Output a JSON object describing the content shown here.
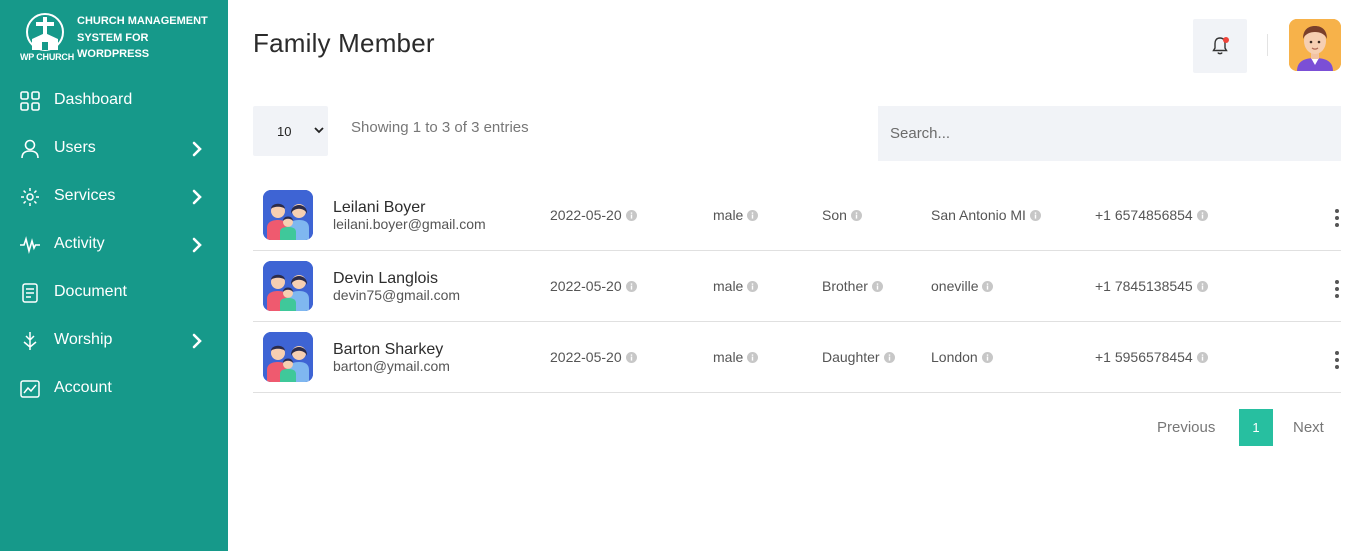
{
  "brand": {
    "logo_text": "WP CHURCH",
    "title": "CHURCH MANAGEMENT SYSTEM FOR WORDPRESS"
  },
  "sidebar": {
    "items": [
      {
        "label": "Dashboard",
        "icon": "dashboard-grid-icon",
        "has_chevron": false
      },
      {
        "label": "Users",
        "icon": "user-icon",
        "has_chevron": true
      },
      {
        "label": "Services",
        "icon": "services-icon",
        "has_chevron": true
      },
      {
        "label": "Activity",
        "icon": "activity-pulse-icon",
        "has_chevron": true
      },
      {
        "label": "Document",
        "icon": "document-icon",
        "has_chevron": false
      },
      {
        "label": "Worship",
        "icon": "worship-icon",
        "has_chevron": true
      },
      {
        "label": "Account",
        "icon": "account-chart-icon",
        "has_chevron": false
      }
    ]
  },
  "header": {
    "title": "Family Member"
  },
  "controls": {
    "page_length": "10",
    "entries_info": "Showing 1 to 3 of 3 entries",
    "search_placeholder": "Search..."
  },
  "members": [
    {
      "name": "Leilani Boyer",
      "email": "leilani.boyer@gmail.com",
      "date": "2022-05-20",
      "gender": "male",
      "relation": "Son",
      "city": "San Antonio MI",
      "phone": "+1 6574856854"
    },
    {
      "name": "Devin Langlois",
      "email": "devin75@gmail.com",
      "date": "2022-05-20",
      "gender": "male",
      "relation": "Brother",
      "city": "oneville",
      "phone": "+1 7845138545"
    },
    {
      "name": "Barton Sharkey",
      "email": "barton@ymail.com",
      "date": "2022-05-20",
      "gender": "male",
      "relation": "Daughter",
      "city": "London",
      "phone": "+1 5956578454"
    }
  ],
  "pagination": {
    "previous": "Previous",
    "current": "1",
    "next": "Next"
  },
  "colors": {
    "sidebar": "#16998a",
    "accent": "#27bfa0",
    "notification_dot": "#f0443a"
  }
}
